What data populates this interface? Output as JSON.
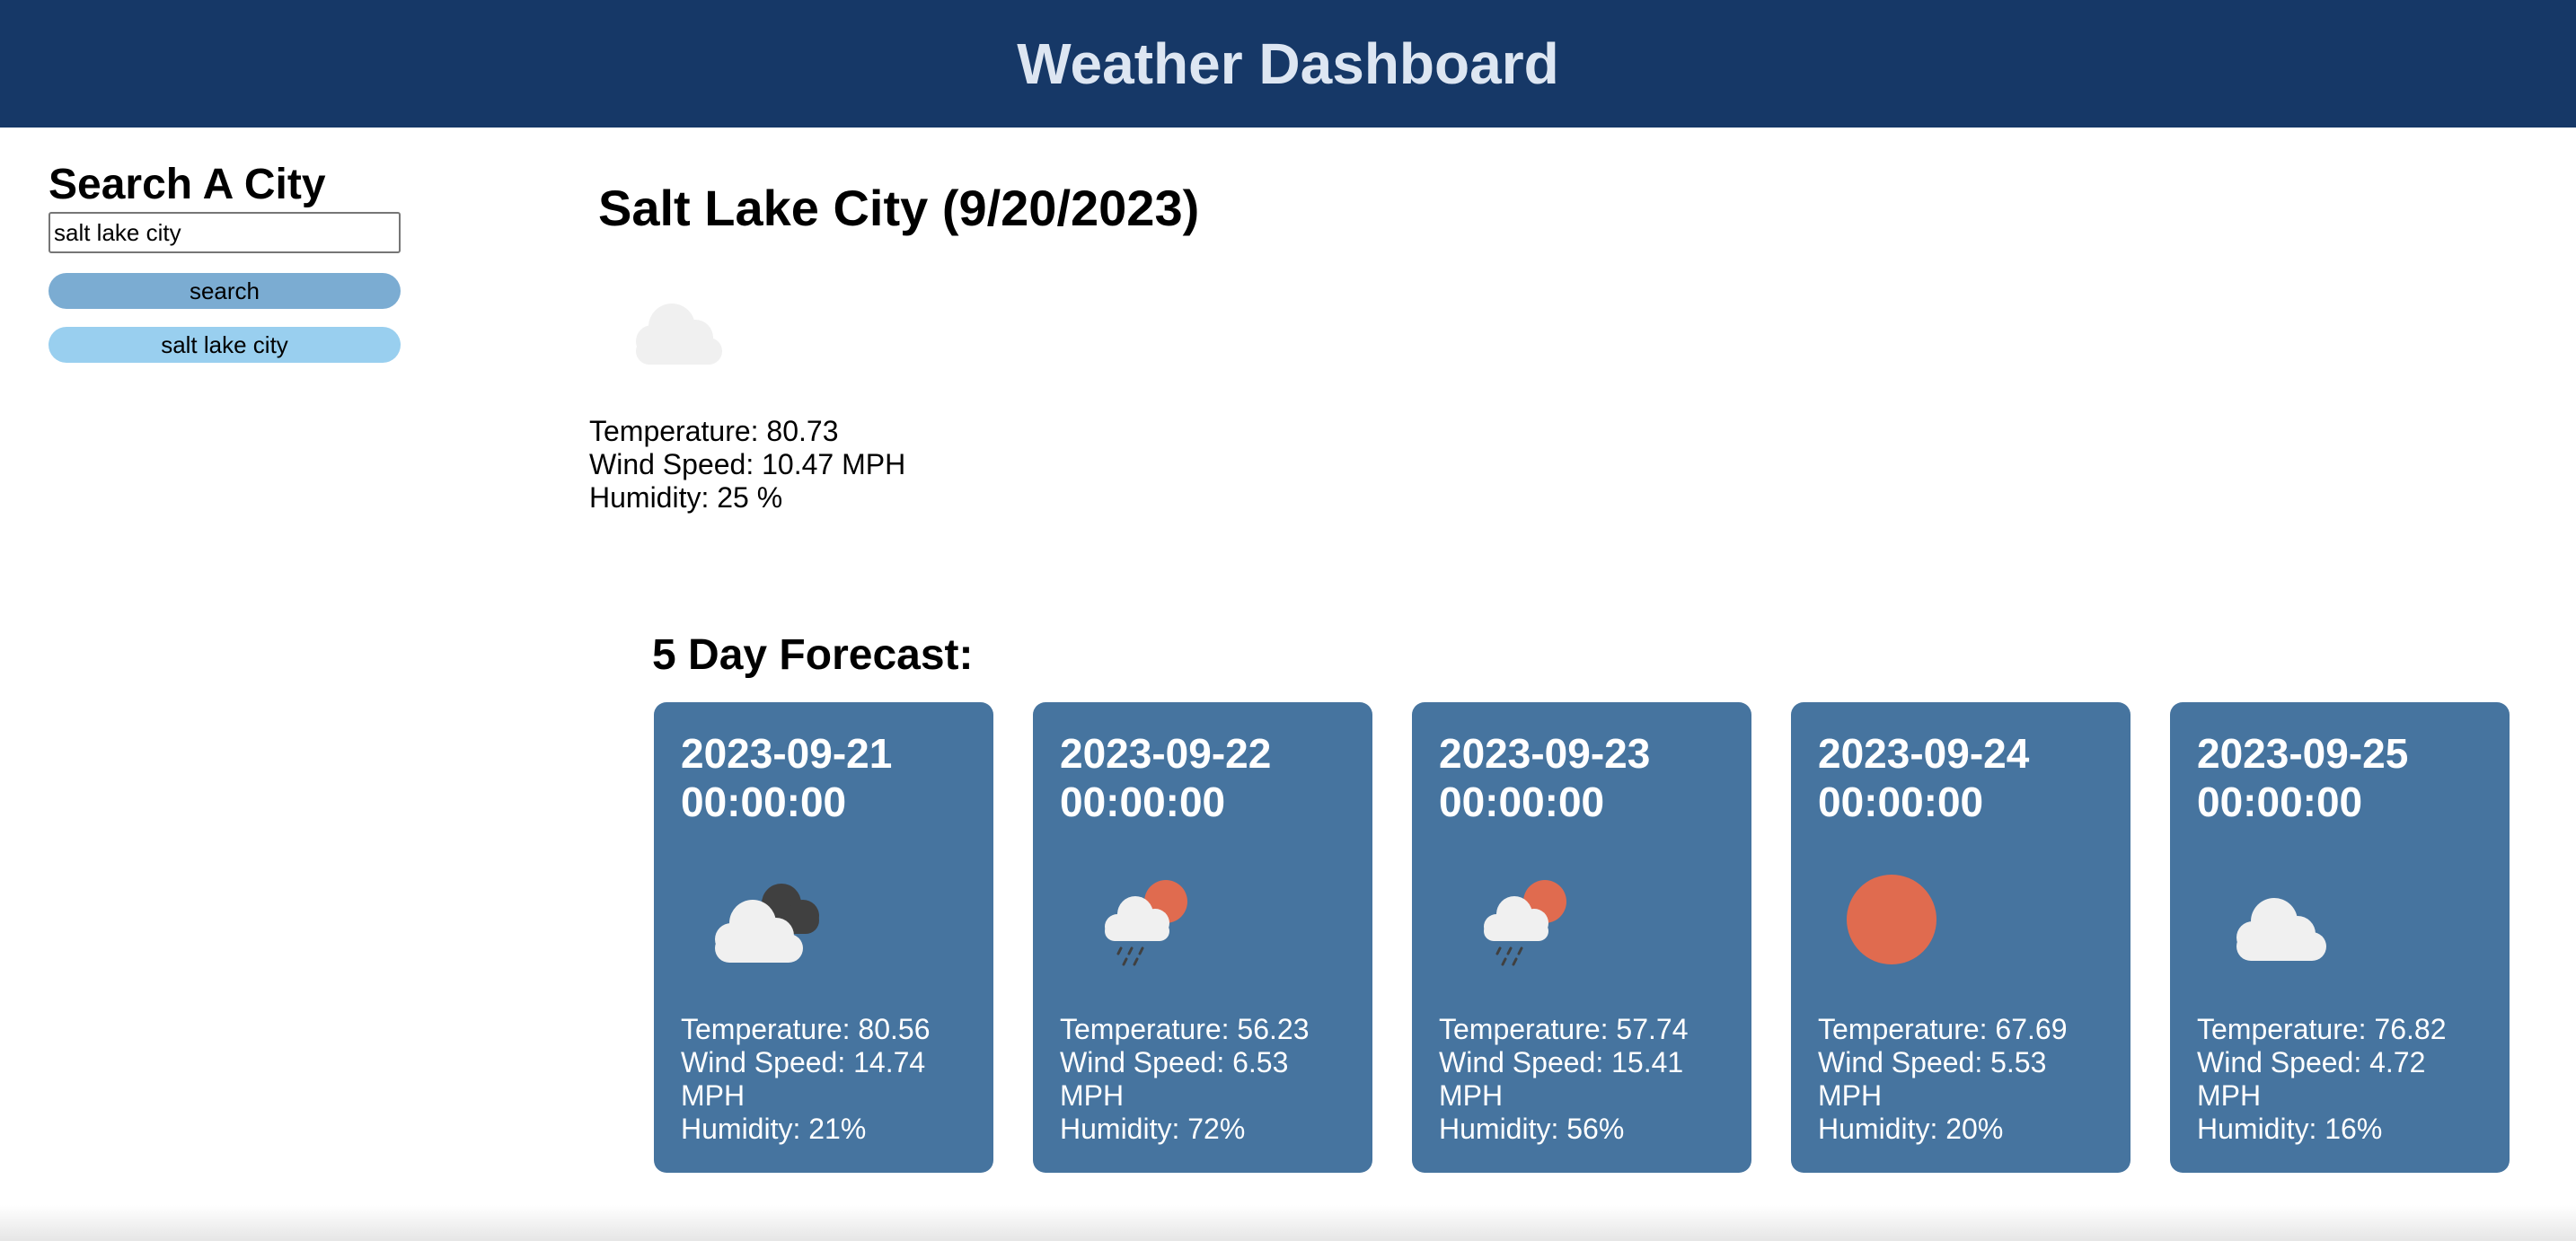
{
  "header": {
    "title": "Weather Dashboard",
    "background_color": "#163867"
  },
  "sidebar": {
    "title": "Search A City",
    "search_input_value": "salt lake city",
    "search_button_label": "search",
    "history": [
      {
        "label": "salt lake city"
      }
    ]
  },
  "current": {
    "title": "Salt Lake City (9/20/2023)",
    "icon": "cloud-icon",
    "temperature": "Temperature: 80.73",
    "wind": "Wind Speed: 10.47 MPH",
    "humidity": "Humidity: 25 %"
  },
  "forecast": {
    "title": "5 Day Forecast:",
    "card_color": "#46749f",
    "days": [
      {
        "date": "2023-09-21 00:00:00",
        "icon": "broken-clouds-icon",
        "temperature": "Temperature: 80.56",
        "wind": "Wind Speed: 14.74 MPH",
        "humidity": "Humidity: 21%"
      },
      {
        "date": "2023-09-22 00:00:00",
        "icon": "sun-rain-cloud-icon",
        "temperature": "Temperature: 56.23",
        "wind": "Wind Speed: 6.53 MPH",
        "humidity": "Humidity: 72%"
      },
      {
        "date": "2023-09-23 00:00:00",
        "icon": "sun-rain-cloud-icon",
        "temperature": "Temperature: 57.74",
        "wind": "Wind Speed: 15.41 MPH",
        "humidity": "Humidity: 56%"
      },
      {
        "date": "2023-09-24 00:00:00",
        "icon": "sun-icon",
        "temperature": "Temperature: 67.69",
        "wind": "Wind Speed: 5.53 MPH",
        "humidity": "Humidity: 20%"
      },
      {
        "date": "2023-09-25 00:00:00",
        "icon": "cloud-icon",
        "temperature": "Temperature: 76.82",
        "wind": "Wind Speed: 4.72 MPH",
        "humidity": "Humidity: 16%"
      }
    ]
  }
}
